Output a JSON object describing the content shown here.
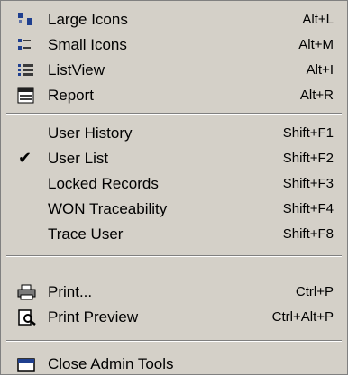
{
  "menu": {
    "view_items": [
      {
        "label": "Large Icons",
        "shortcut": "Alt+L",
        "icon": "large-icons-icon"
      },
      {
        "label": "Small Icons",
        "shortcut": "Alt+M",
        "icon": "small-icons-icon"
      },
      {
        "label": "ListView",
        "shortcut": "Alt+I",
        "icon": "list-view-icon"
      },
      {
        "label": "Report",
        "shortcut": "Alt+R",
        "icon": "report-icon"
      }
    ],
    "history_items": [
      {
        "label": "User History",
        "shortcut": "Shift+F1",
        "checked": false
      },
      {
        "label": "User List",
        "shortcut": "Shift+F2",
        "checked": true
      },
      {
        "label": "Locked Records",
        "shortcut": "Shift+F3",
        "checked": false
      },
      {
        "label": "WON Traceability",
        "shortcut": "Shift+F4",
        "checked": false
      },
      {
        "label": "Trace User",
        "shortcut": "Shift+F8",
        "checked": false
      }
    ],
    "print_items": [
      {
        "label": "Print...",
        "shortcut": "Ctrl+P",
        "icon": "printer-icon"
      },
      {
        "label": "Print Preview",
        "shortcut": "Ctrl+Alt+P",
        "icon": "print-preview-icon"
      }
    ],
    "close_item": {
      "label": "Close Admin Tools",
      "icon": "close-admin-tools-icon"
    },
    "checkmark_glyph": "✔"
  }
}
